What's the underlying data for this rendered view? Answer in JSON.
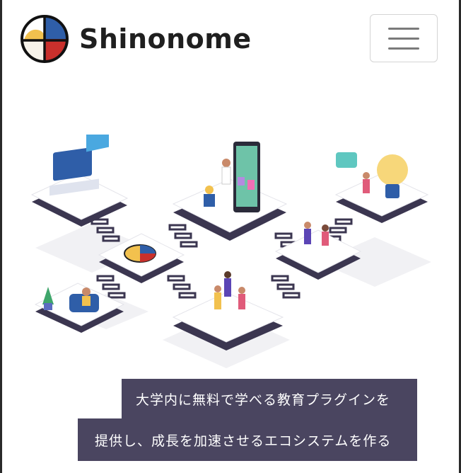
{
  "header": {
    "brand_name": "Shinonome",
    "menu_button_icon": "hamburger-icon"
  },
  "hero": {
    "illustration": "isometric-platforms-with-people-illustration",
    "caption_line1": "大学内に無料で学べる教育プラグインを",
    "caption_line2": "提供し、成長を加速させるエコシステムを作る"
  },
  "colors": {
    "caption_bg": "#4a4560",
    "logo_blue": "#2f5ea8",
    "logo_yellow": "#f2c14e",
    "logo_red": "#c9302c",
    "platform_top": "#ffffff",
    "platform_side": "#3b3650"
  }
}
